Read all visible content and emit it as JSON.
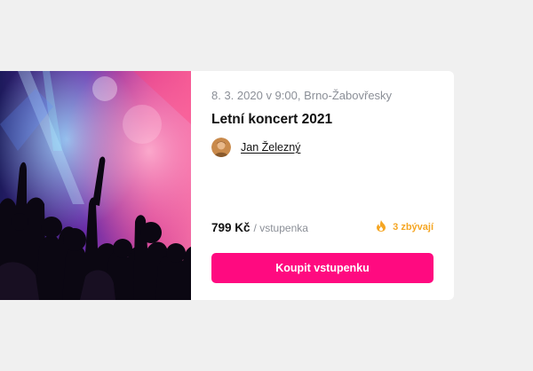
{
  "event": {
    "meta": "8. 3. 2020 v 9:00, Brno-Žabovřesky",
    "title": "Letní koncert 2021",
    "author": {
      "name": "Jan Železný"
    },
    "price": "799 Kč",
    "price_unit": "/ vstupenka",
    "remaining": "3 zbývají",
    "buy_label": "Koupit vstupenku"
  },
  "icons": {
    "remaining": "fire-icon",
    "author": "avatar"
  },
  "colors": {
    "accent": "#ff0a80",
    "warning": "#f5a623",
    "muted": "#8b8f97"
  }
}
